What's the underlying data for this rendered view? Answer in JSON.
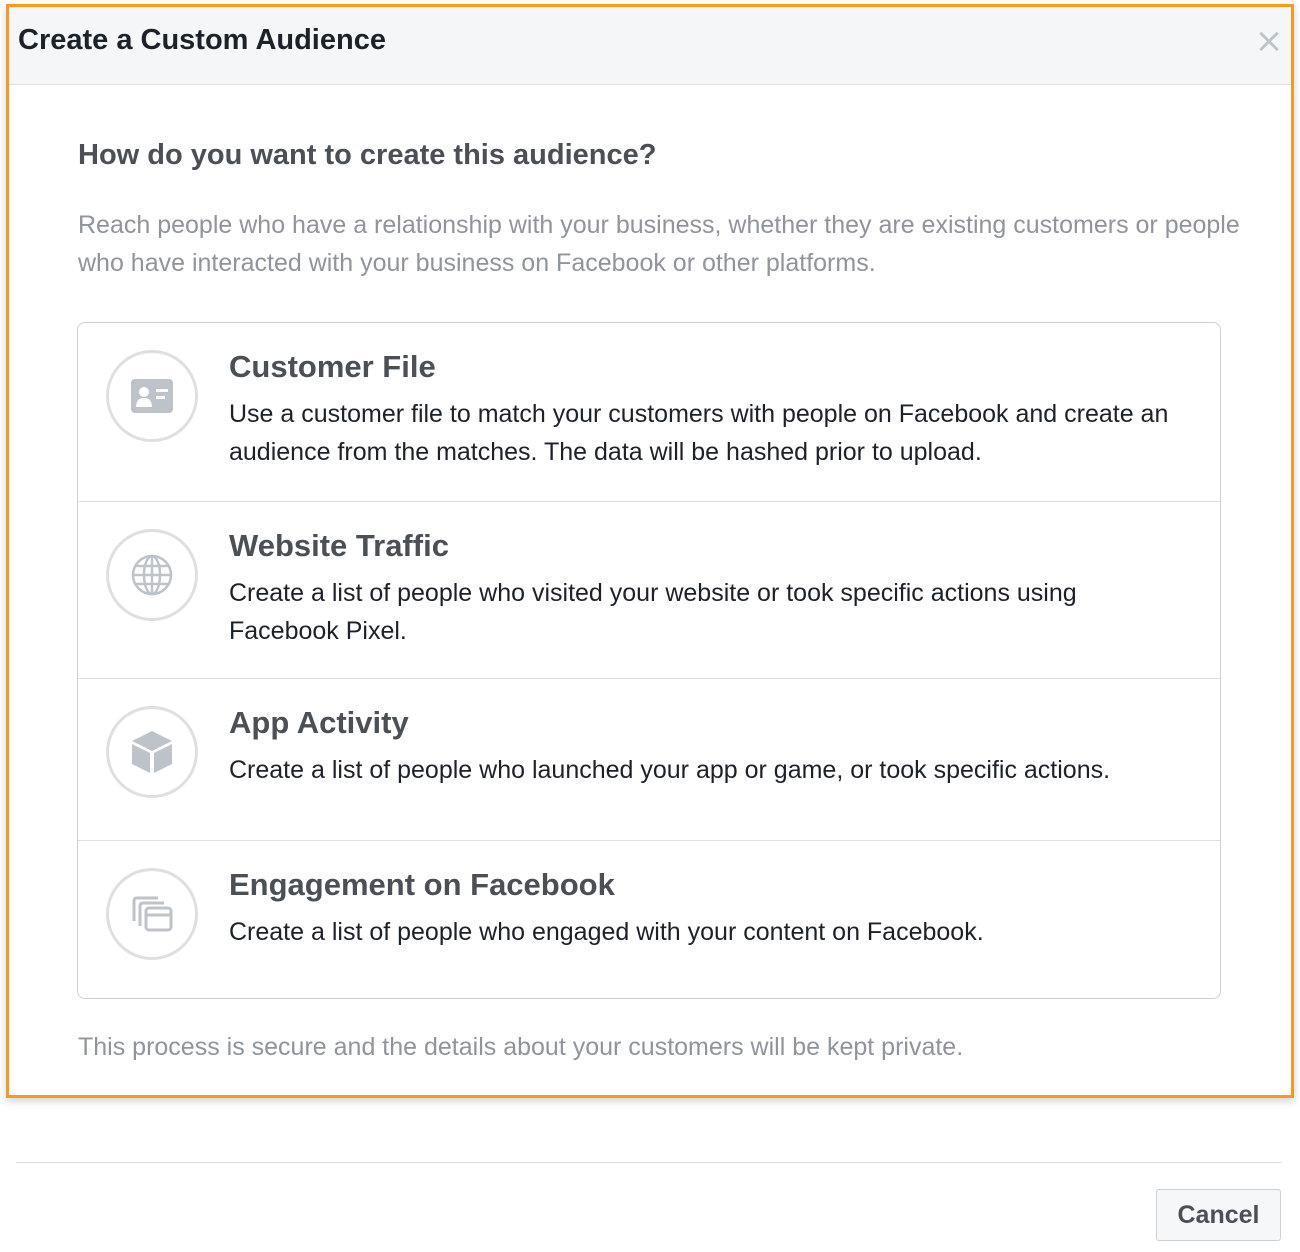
{
  "dialog": {
    "title": "Create a Custom Audience",
    "close_icon": "close-icon",
    "accent_border_color": "#f79a1e"
  },
  "main": {
    "question": "How do you want to create this audience?",
    "description": "Reach people who have a relationship with your business, whether they are existing customers or people who have interacted with your business on Facebook or other platforms.",
    "options": [
      {
        "icon": "contact-card-icon",
        "title": "Customer File",
        "description": "Use a customer file to match your customers with people on Facebook and create an audience from the matches. The data will be hashed prior to upload."
      },
      {
        "icon": "globe-icon",
        "title": "Website Traffic",
        "description": "Create a list of people who visited your website or took specific actions using Facebook Pixel."
      },
      {
        "icon": "cube-icon",
        "title": "App Activity",
        "description": "Create a list of people who launched your app or game, or took specific actions."
      },
      {
        "icon": "stacked-cards-icon",
        "title": "Engagement on Facebook",
        "description": "Create a list of people who engaged with your content on Facebook."
      }
    ],
    "footer_note": "This process is secure and the details about your customers will be kept private."
  },
  "footer": {
    "cancel_label": "Cancel"
  }
}
